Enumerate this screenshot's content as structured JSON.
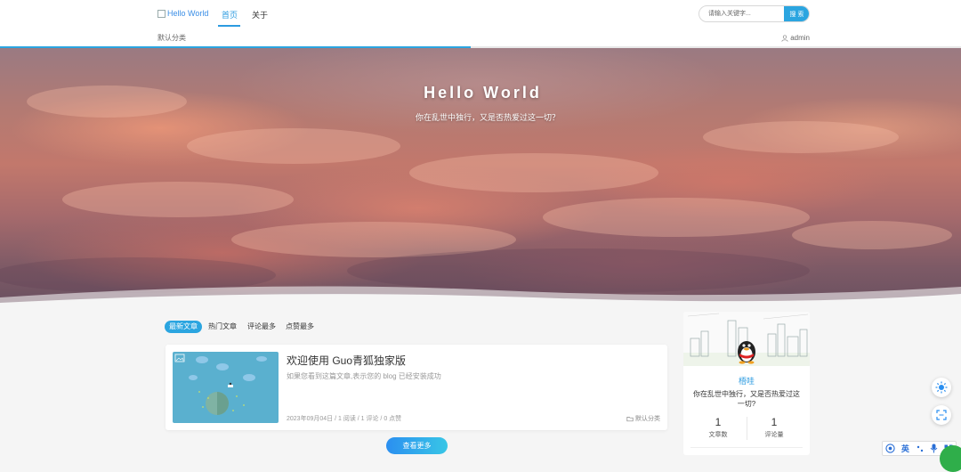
{
  "nav": {
    "logo_alt": "Hello World",
    "items": [
      {
        "label": "首页",
        "active": true
      },
      {
        "label": "关于",
        "active": false
      }
    ],
    "search": {
      "placeholder": "请输入关键字...",
      "button": "搜 索"
    }
  },
  "subbar": {
    "category": "默认分类",
    "user": "admin",
    "progress": 0.49
  },
  "hero": {
    "title": "Hello World",
    "subtitle": "你在乱世中独行，又是否热爱过这一切？"
  },
  "tabs": [
    {
      "label": "最新文章",
      "active": true
    },
    {
      "label": "热门文章",
      "active": false
    },
    {
      "label": "评论最多",
      "active": false
    },
    {
      "label": "点赞最多",
      "active": false
    }
  ],
  "post": {
    "title": "欢迎使用 Guo青狐独家版",
    "excerpt": "如果您看到这篇文章,表示您的 blog 已经安装成功",
    "meta": "2023年09月04日 / 1 阅读 / 1 评论 / 0 点赞",
    "category": "默认分类"
  },
  "more_button": "查看更多",
  "profile": {
    "name": "梧哇",
    "bio": "你在乱世中独行，又是否热爱过这一切?",
    "stats": [
      {
        "value": "1",
        "label": "文章数"
      },
      {
        "value": "1",
        "label": "评论量"
      }
    ]
  },
  "ime": {
    "lang": "英"
  },
  "colors": {
    "accent": "#2ba5e0",
    "nav_active": "#2c9be0",
    "profile_name": "#2c9be0"
  }
}
